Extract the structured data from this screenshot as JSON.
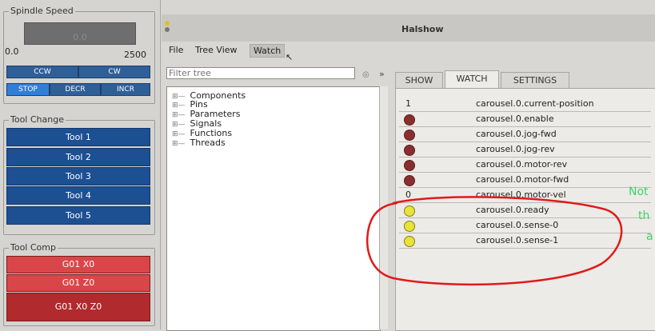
{
  "spindle": {
    "title": "Spindle Speed",
    "display_value": "0.0",
    "range_min": "0.0",
    "range_max": "2500",
    "buttons": {
      "ccw": "CCW",
      "cw": "CW",
      "stop": "STOP",
      "decr": "DECR",
      "incr": "INCR"
    }
  },
  "tool_change": {
    "title": "Tool Change",
    "tools": [
      "Tool 1",
      "Tool 2",
      "Tool 3",
      "Tool 4",
      "Tool 5"
    ]
  },
  "tool_comp": {
    "title": "Tool Comp",
    "buttons": [
      "G01 X0",
      "G01 Z0",
      "G01 X0 Z0"
    ]
  },
  "window": {
    "title": "Halshow"
  },
  "menu": {
    "file": "File",
    "tree_view": "Tree View",
    "watch": "Watch"
  },
  "filter": {
    "placeholder": "Filter tree"
  },
  "tree": {
    "items": [
      "Components",
      "Pins",
      "Parameters",
      "Signals",
      "Functions",
      "Threads"
    ]
  },
  "tabs": {
    "show": "SHOW",
    "watch": "WATCH",
    "settings": "SETTINGS"
  },
  "watch_rows": [
    {
      "value": "1",
      "name": "carousel.0.current-position"
    },
    {
      "led": "off",
      "name": "carousel.0.enable"
    },
    {
      "led": "off",
      "name": "carousel.0.jog-fwd"
    },
    {
      "led": "off",
      "name": "carousel.0.jog-rev"
    },
    {
      "led": "off",
      "name": "carousel.0.motor-rev"
    },
    {
      "led": "off",
      "name": "carousel.0.motor-fwd"
    },
    {
      "value": "0",
      "name": "carousel.0.motor-vel"
    },
    {
      "led": "on",
      "name": "carousel.0.ready"
    },
    {
      "led": "on",
      "name": "carousel.0.sense-0"
    },
    {
      "led": "on",
      "name": "carousel.0.sense-1"
    }
  ],
  "annotation": {
    "line1": "Not",
    "line2": "th",
    "line3": "a"
  },
  "colors": {
    "led_on": "#e7e33a",
    "led_off": "#8a2f30",
    "tool_blue": "#1d4f93",
    "comp_red": "#cf3b3e",
    "annotation_red": "#e01a1a",
    "annotation_green": "#3ed26b"
  }
}
